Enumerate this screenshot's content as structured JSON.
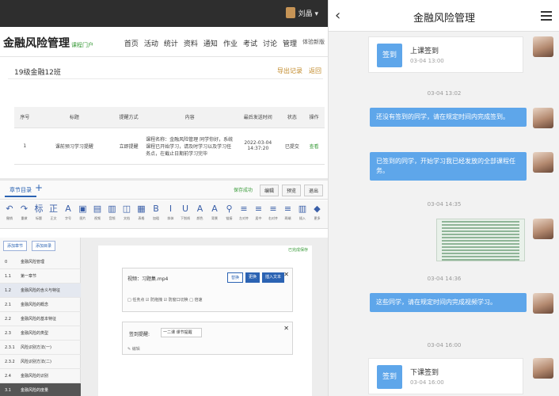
{
  "desktop": {
    "user_label": "刘晶 ▾",
    "brand": "金融风险管理",
    "brand_tag": "课程门户",
    "nav": [
      "首页",
      "活动",
      "统计",
      "资料",
      "通知",
      "作业",
      "考试",
      "讨论",
      "管理"
    ],
    "nav_extra": "体验新版",
    "class_name": "19级金融12班",
    "export_label": "导出记录",
    "back_label": "返回",
    "table": {
      "headers": [
        "序号",
        "标题",
        "提醒方式",
        "内容",
        "最后发送时间",
        "状态",
        "操作"
      ],
      "rows": [
        [
          "1",
          "课前预习学习提醒",
          "立即提醒",
          "课程名称：金融风险管理 同学你好，系统课程已开始学习，请及时学习以及学习任务点，在截止日期前学习完毕",
          "2022-03-04 14:37:20",
          "已提交",
          "查看"
        ]
      ]
    },
    "editor_tab": "章节目录",
    "editor_plus": "+",
    "editor_buttons": [
      "保存成功",
      "编辑",
      "预览",
      "退出"
    ],
    "toolbar": [
      {
        "icon": "↶",
        "label": "撤销"
      },
      {
        "icon": "↷",
        "label": "重做"
      },
      {
        "icon": "标",
        "label": "标题"
      },
      {
        "icon": "正",
        "label": "正文"
      },
      {
        "icon": "A",
        "label": "字号"
      },
      {
        "icon": "▣",
        "label": "图片"
      },
      {
        "icon": "▤",
        "label": "视频"
      },
      {
        "icon": "▥",
        "label": "音频"
      },
      {
        "icon": "◫",
        "label": "文档"
      },
      {
        "icon": "▦",
        "label": "表格"
      },
      {
        "icon": "B",
        "label": "加粗"
      },
      {
        "icon": "I",
        "label": "斜体"
      },
      {
        "icon": "U",
        "label": "下划线"
      },
      {
        "icon": "A",
        "label": "颜色"
      },
      {
        "icon": "A",
        "label": "背景"
      },
      {
        "icon": "⚲",
        "label": "链接"
      },
      {
        "icon": "≡",
        "label": "左对齐"
      },
      {
        "icon": "≡",
        "label": "居中"
      },
      {
        "icon": "≡",
        "label": "右对齐"
      },
      {
        "icon": "≡",
        "label": "两端"
      },
      {
        "icon": "▥",
        "label": "插入"
      },
      {
        "icon": "◆",
        "label": "更多"
      }
    ],
    "outline_buttons": [
      "添加章节",
      "添加目录"
    ],
    "outline": [
      {
        "num": "0",
        "text": "金融风险管理",
        "state": "normal"
      },
      {
        "num": "1.1",
        "text": "第一章节",
        "state": "normal"
      },
      {
        "num": "1.2",
        "text": "金融风险的含义与特征",
        "state": "sel"
      },
      {
        "num": "2.1",
        "text": "金融风险的概念",
        "state": "normal"
      },
      {
        "num": "2.2",
        "text": "金融风险的基本特征",
        "state": "normal"
      },
      {
        "num": "2.3",
        "text": "金融风险的类型",
        "state": "normal"
      },
      {
        "num": "2.3.1",
        "text": "风险识别方法(一)",
        "state": "normal"
      },
      {
        "num": "2.3.2",
        "text": "风险识别方法(二)",
        "state": "normal"
      },
      {
        "num": "2.4",
        "text": "金融风险的识别",
        "state": "normal"
      },
      {
        "num": "3.1",
        "text": "金融风险的度量",
        "state": "dark"
      }
    ],
    "save_tip": "已完成保存",
    "video_title": "视频：习题集.mp4",
    "video_buttons": [
      "替换",
      "更换",
      "插入文本"
    ],
    "video_options": "□ 任务点  ☑ 防拖拽  ☑ 防窗口切换  □ 倍速",
    "sign_label": "签到提醒:",
    "sign_value": "一二课 课节提醒",
    "sign_footer": "✎ 编辑"
  },
  "mobile": {
    "title": "金融风险管理",
    "back_icon": "‹",
    "menu_icon": "hamburger-icon",
    "messages": [
      {
        "kind": "card",
        "icon_label": "签到",
        "title": "上课签到",
        "time": "03-04 13:00"
      },
      {
        "kind": "timestamp",
        "text": "03-04 13:02"
      },
      {
        "kind": "text",
        "text": "还没有签到的同学，请在规定时间内完成签到。"
      },
      {
        "kind": "text",
        "text": "已签到的同学，开始学习我已经发放的全部课程任务。"
      },
      {
        "kind": "timestamp",
        "text": "03-04 14:35"
      },
      {
        "kind": "image",
        "text": "spreadsheet-screenshot"
      },
      {
        "kind": "timestamp",
        "text": "03-04 14:36"
      },
      {
        "kind": "text",
        "text": "这些同学，请在规定时间内完成视频学习。"
      },
      {
        "kind": "timestamp",
        "text": "03-04 16:00"
      },
      {
        "kind": "card",
        "icon_label": "签到",
        "title": "下课签到",
        "time": "03-04 16:00"
      }
    ]
  }
}
